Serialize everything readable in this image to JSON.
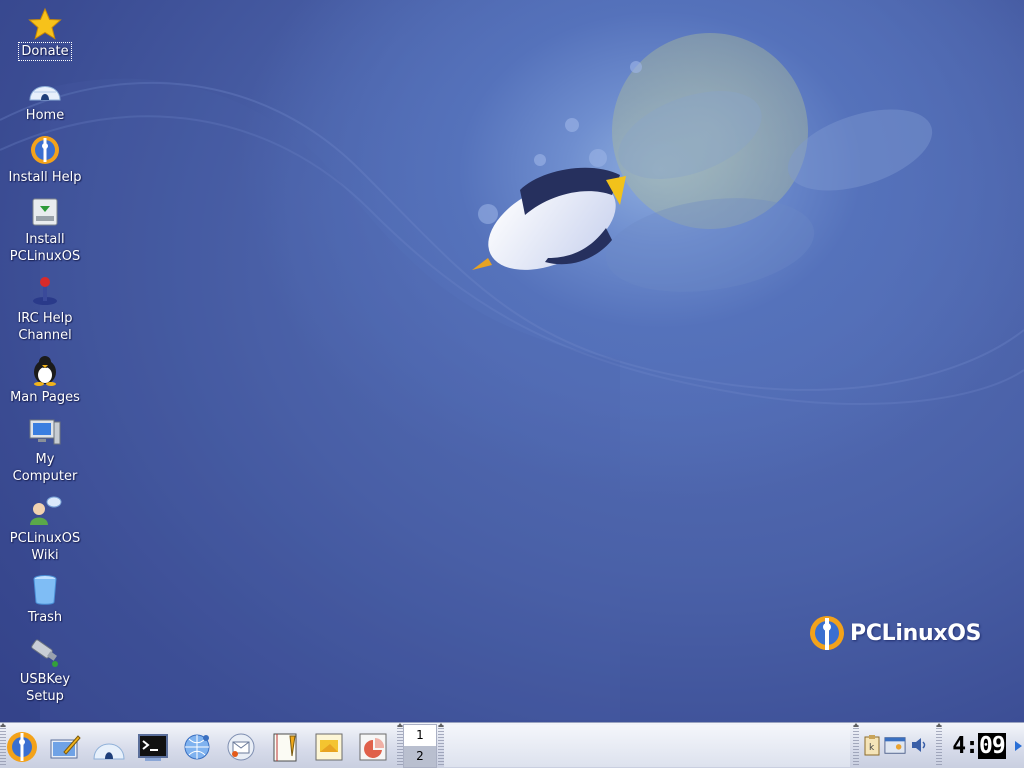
{
  "desktop": {
    "icons": [
      {
        "label": "Donate",
        "icon": "star-icon"
      },
      {
        "label": "Home",
        "icon": "igloo-home-icon"
      },
      {
        "label": "Install Help",
        "icon": "pclinuxos-globe-icon"
      },
      {
        "label": "Install PCLinuxOS",
        "icon": "installer-disk-icon"
      },
      {
        "label": "IRC Help Channel",
        "icon": "joystick-irc-icon"
      },
      {
        "label": "Man Pages",
        "icon": "tux-penguin-icon"
      },
      {
        "label": "My Computer",
        "icon": "computer-icon"
      },
      {
        "label": "PCLinuxOS Wiki",
        "icon": "wiki-user-chat-icon"
      },
      {
        "label": "Trash",
        "icon": "trash-can-icon"
      },
      {
        "label": "USBKey Setup",
        "icon": "usb-key-icon"
      }
    ],
    "selected_icon": "Donate",
    "wallpaper_brand": "PCLinuxOS",
    "colors": {
      "background": "#3b4f95",
      "glow": "#8faedf"
    }
  },
  "taskbar": {
    "launchers": [
      {
        "name": "kmenu-button",
        "icon": "pclinuxos-globe-icon"
      },
      {
        "name": "show-desktop",
        "icon": "desktop-pen-icon"
      },
      {
        "name": "home-folder",
        "icon": "igloo-home-icon"
      },
      {
        "name": "terminal",
        "icon": "terminal-icon"
      },
      {
        "name": "web-browser",
        "icon": "network-globe-icon"
      },
      {
        "name": "email-client",
        "icon": "mail-icon"
      },
      {
        "name": "text-editor",
        "icon": "notebook-icon"
      },
      {
        "name": "presentation",
        "icon": "presentation-icon"
      },
      {
        "name": "charts",
        "icon": "chart-icon"
      }
    ],
    "pager": {
      "desktops": [
        "1",
        "2"
      ],
      "active": "1"
    },
    "tray": [
      "klipper-icon",
      "kmix-mixer-icon",
      "speaker-volume-icon"
    ],
    "clock": {
      "hours": "4",
      "sep": ":",
      "minutes": "09"
    }
  }
}
